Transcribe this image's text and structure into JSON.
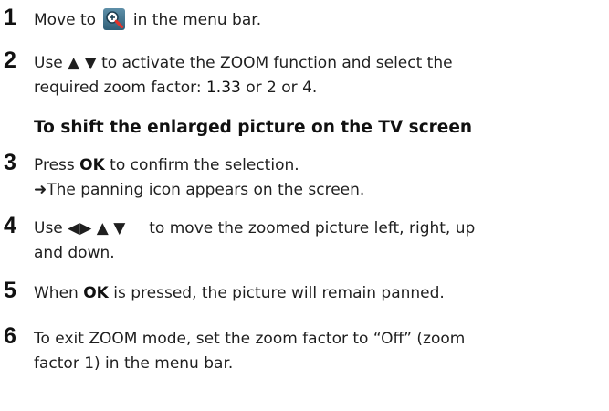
{
  "steps": [
    {
      "number": "1",
      "part_a": "Move to",
      "icon": "zoom-magnifier-icon",
      "part_b": "in the menu bar."
    },
    {
      "number": "2",
      "line1_a": "Use ▲ ▼ to activate the ZOOM function and select the",
      "line2_a": "required zoom factor: ",
      "f1": "1.33",
      "or1": " or ",
      "f2": "2",
      "or2": " or ",
      "f3": "4",
      "end": "."
    },
    {
      "number": "3",
      "line1_a": "Press ",
      "ok": "OK",
      "line1_b": " to confirm the selection.",
      "line2": "➜The panning icon appears on the screen."
    },
    {
      "number": "4",
      "line1_a": "Use ◀▶ ▲ ▼",
      "line1_b": "to move the zoomed picture left, right, up",
      "line2": "and down."
    },
    {
      "number": "5",
      "line1_a": "When ",
      "ok": "OK",
      "line1_b": " is pressed, the picture will remain panned."
    },
    {
      "number": "6",
      "line1_a": "To exit ZOOM mode, set the zoom factor to “",
      "off": "Off",
      "line1_b": "” (zoom",
      "line2": "factor 1) in the menu bar."
    }
  ],
  "heading": "To shift the enlarged picture on the TV screen"
}
